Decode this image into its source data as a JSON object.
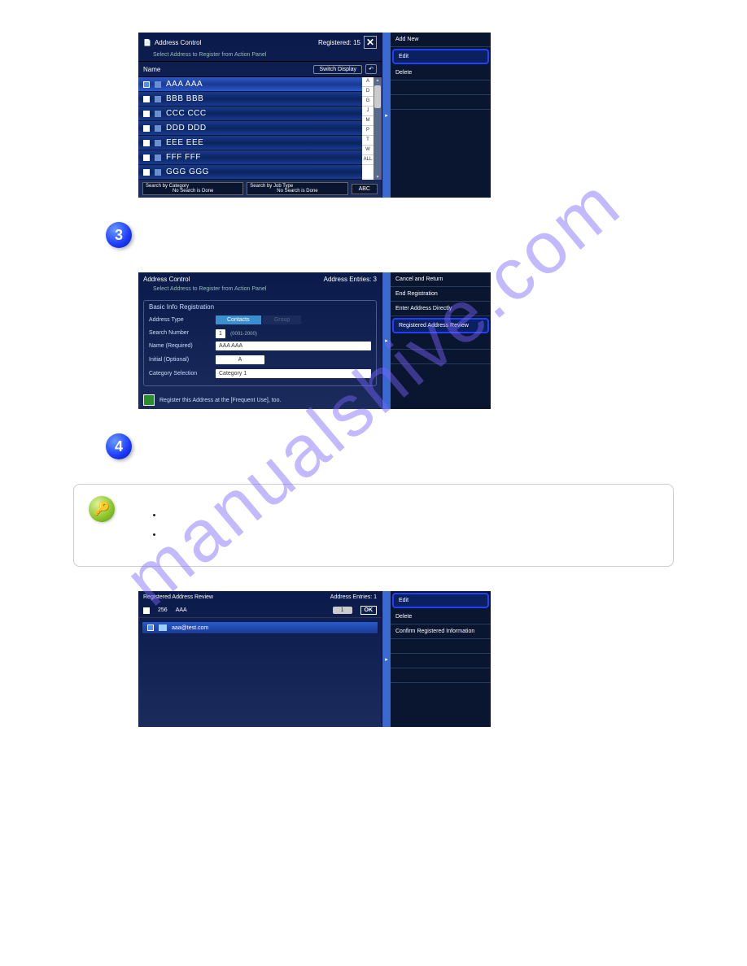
{
  "watermark": "manualshive.com",
  "panel1": {
    "title": "Address Control",
    "registered": "Registered: 15",
    "subtitle": "Select Address to Register from Action Panel",
    "name_label": "Name",
    "switch_display": "Switch Display",
    "items": [
      "AAA AAA",
      "BBB BBB",
      "CCC CCC",
      "DDD DDD",
      "EEE EEE",
      "FFF FFF",
      "GGG GGG"
    ],
    "index_letters": [
      "A",
      "D",
      "G",
      "J",
      "M",
      "P",
      "T",
      "W",
      "ALL"
    ],
    "search_category": "Search by Category",
    "search_jobtype": "Search by Job Type",
    "no_search": "No Search is Done",
    "abc": "ABC",
    "side": {
      "add_new": "Add New",
      "edit": "Edit",
      "delete": "Delete"
    }
  },
  "step3": "3",
  "panel2": {
    "title": "Address Control",
    "entries": "Address Entries: 3",
    "subtitle": "Select Address to Register from Action Panel",
    "section": "Basic Info Registration",
    "rows": {
      "addr_type": "Address Type",
      "type_contacts": "Contacts",
      "type_group": "Group",
      "search_no": "Search Number",
      "search_val": "1",
      "search_hint": "(0001-2000)",
      "name_req": "Name (Required)",
      "name_val": "AAA AAA",
      "initial": "Initial (Optional)",
      "initial_val": "A",
      "category": "Category Selection",
      "category_val": "Category 1"
    },
    "register_freq": "Register this Address at the [Frequent Use], too.",
    "side": {
      "cancel": "Cancel and Return",
      "end": "End Registration",
      "direct": "Enter Address Directly",
      "review": "Registered Address Review"
    }
  },
  "step4": "4",
  "tip": {
    "bullet1": "",
    "bullet2": ""
  },
  "panel3": {
    "title": "Registered Address Review",
    "entries": "Address Entries: 1",
    "num": "256",
    "name": "AAA",
    "one": "1",
    "ok": "OK",
    "email": "aaa@test.com",
    "side": {
      "edit": "Edit",
      "delete": "Delete",
      "confirm": "Confirm Registered Information"
    }
  }
}
